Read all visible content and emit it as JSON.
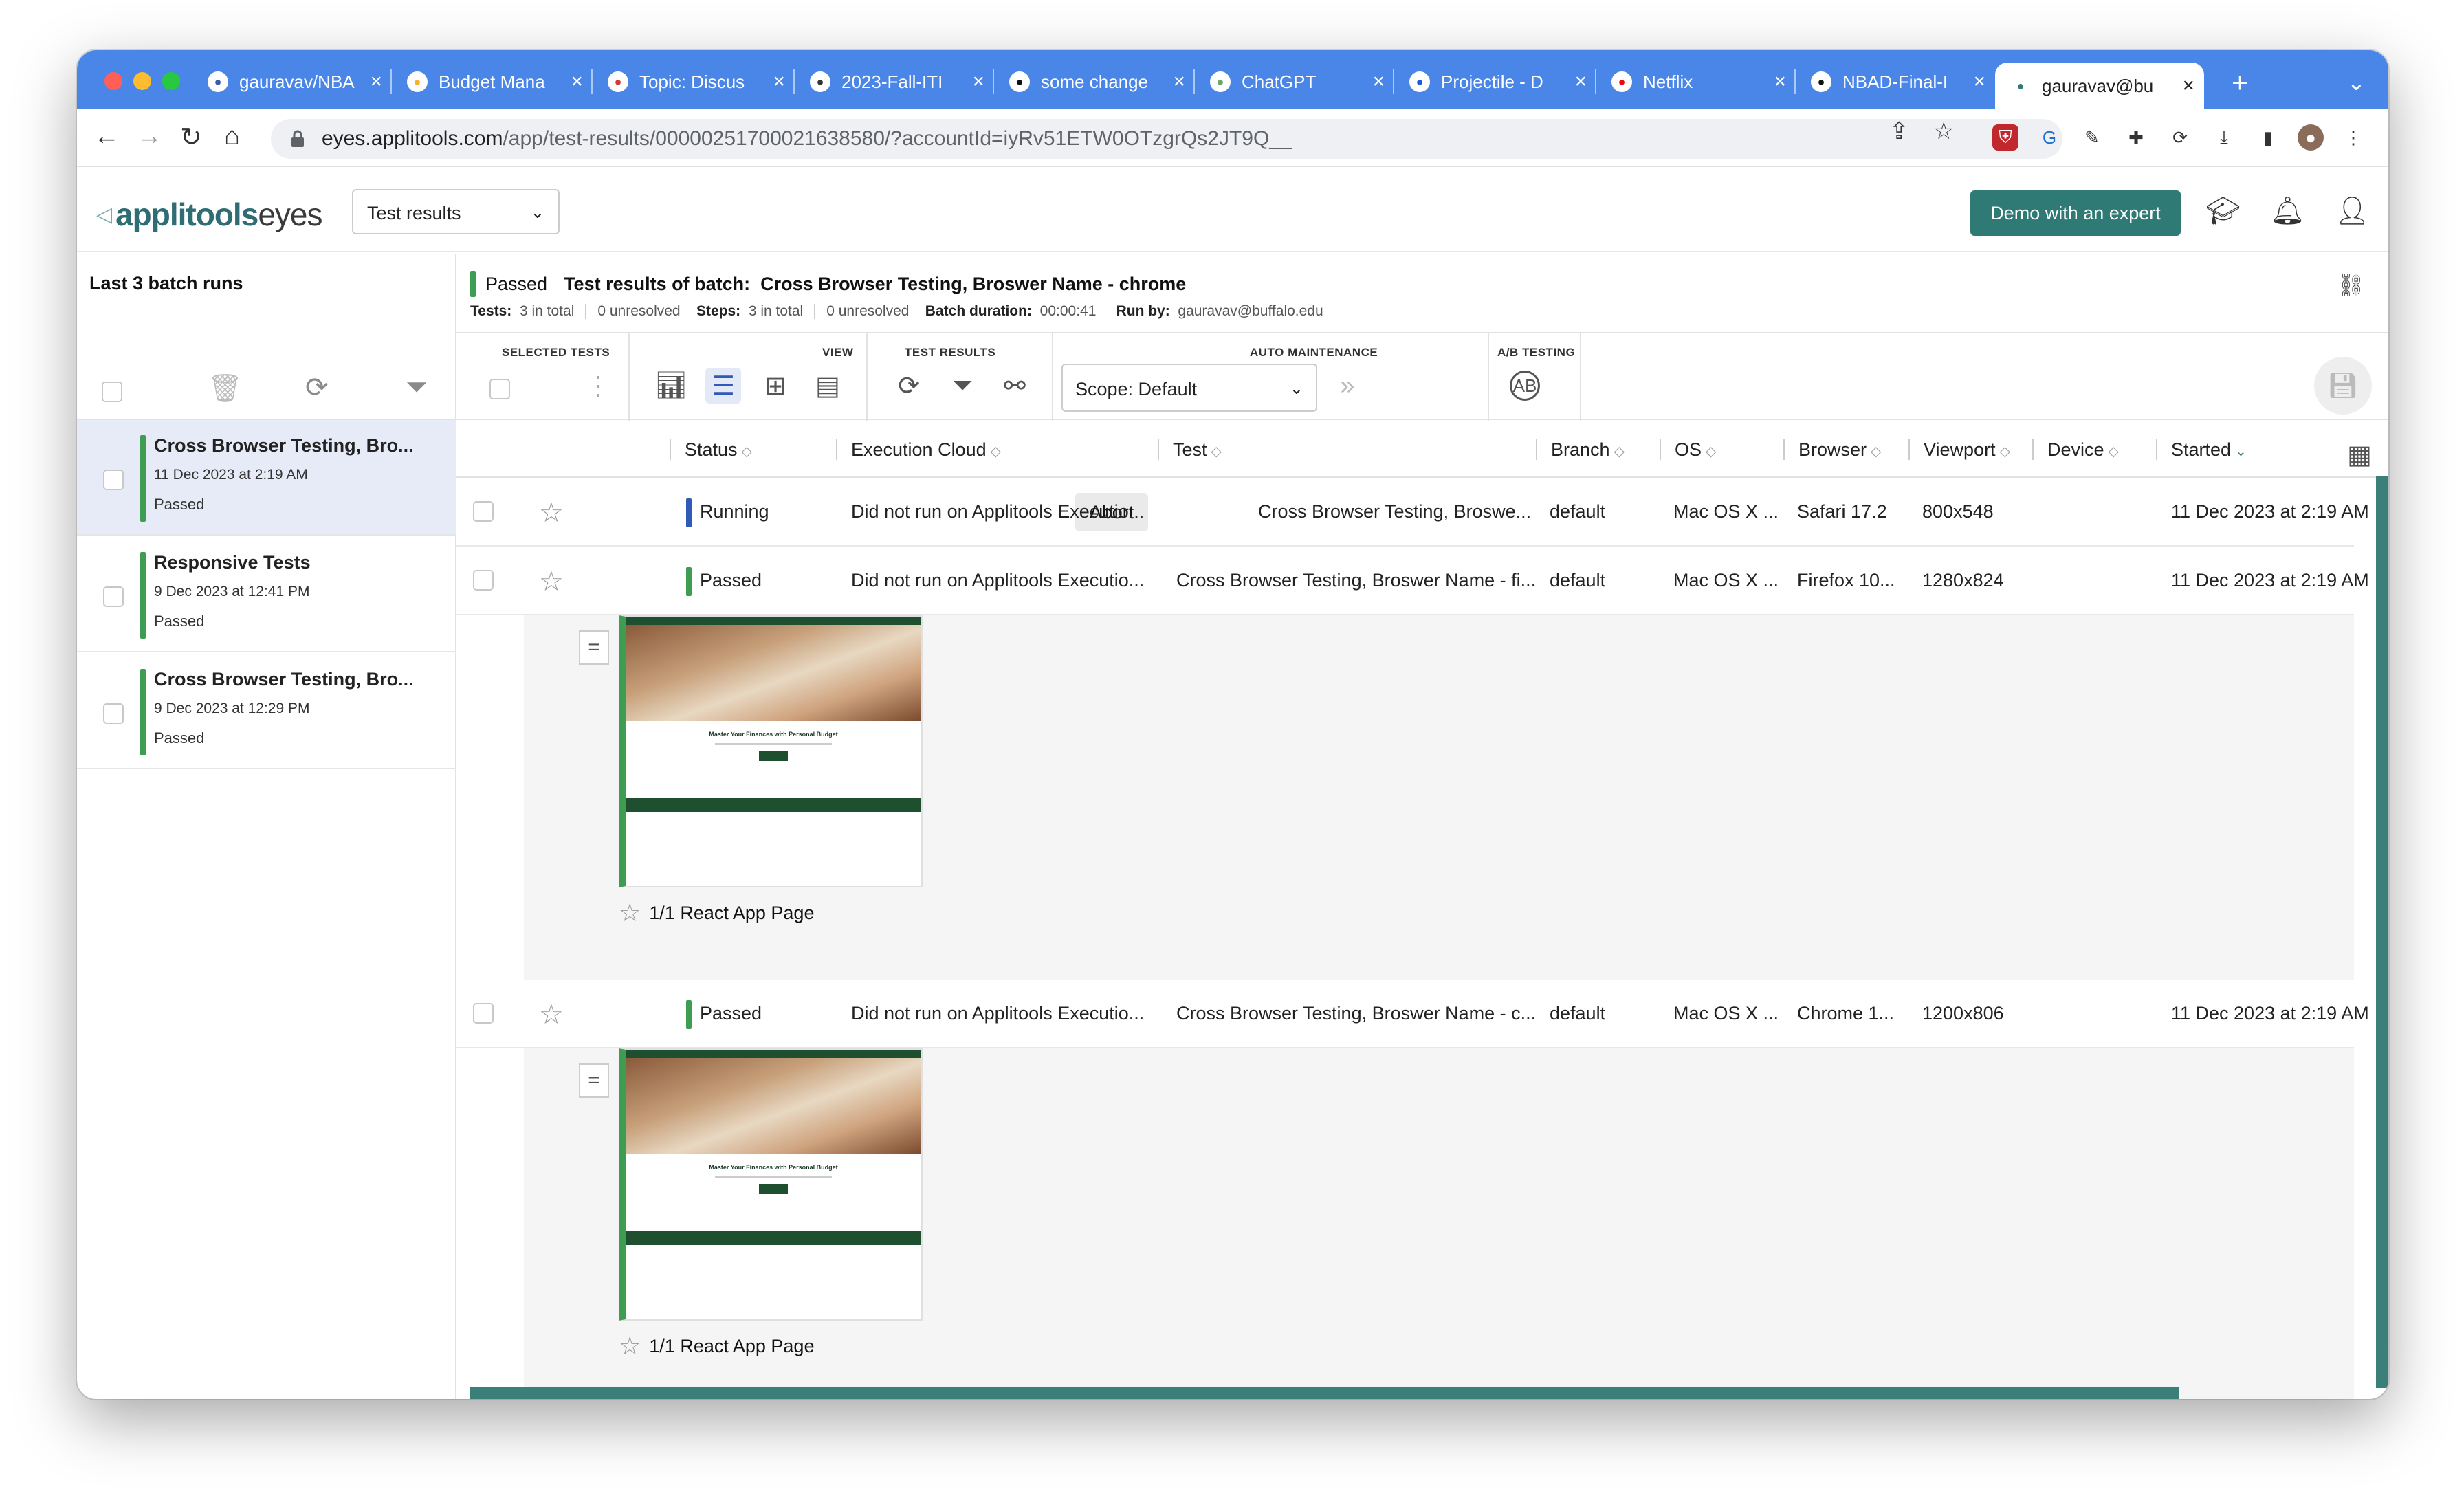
{
  "browser": {
    "tabs": [
      {
        "title": "gauravav/NBA",
        "icon": "github-circle-icon",
        "color": "#3a5ba8"
      },
      {
        "title": "Budget Mana",
        "icon": "budget-app-icon",
        "color": "#f2b233"
      },
      {
        "title": "Topic: Discus",
        "icon": "discourse-icon",
        "color": "#d23a3a"
      },
      {
        "title": "2023-Fall-ITI",
        "icon": "p-icon",
        "color": "#333333"
      },
      {
        "title": "some change",
        "icon": "github-icon",
        "color": "#111111"
      },
      {
        "title": "ChatGPT",
        "icon": "chatgpt-icon",
        "color": "#6aa86a"
      },
      {
        "title": "Projectile - D",
        "icon": "projectile-icon",
        "color": "#1e5bd8"
      },
      {
        "title": "Netflix",
        "icon": "netflix-icon",
        "color": "#e50914"
      },
      {
        "title": "NBAD-Final-I",
        "icon": "github-icon",
        "color": "#111111"
      },
      {
        "title": "gauravav@bu",
        "icon": "applitools-icon",
        "color": "#2f7a74"
      }
    ],
    "url_host": "eyes.applitools.com",
    "url_path": "/app/test-results/00000251700021638580/?accountId=iyRv51ETW0OTzgrQs2JT9Q__"
  },
  "app": {
    "logo_a": "applitools",
    "logo_b": "eyes",
    "view_select": "Test results",
    "demo_button": "Demo with an expert",
    "accent": "#2f7a74"
  },
  "sidebar": {
    "title": "Last 3 batch runs",
    "batches": [
      {
        "name": "Cross Browser Testing, Bro...",
        "date": "11 Dec 2023 at 2:19 AM",
        "status": "Passed"
      },
      {
        "name": "Responsive Tests",
        "date": "9 Dec 2023 at 12:41 PM",
        "status": "Passed"
      },
      {
        "name": "Cross Browser Testing, Bro...",
        "date": "9 Dec 2023 at 12:29 PM",
        "status": "Passed"
      }
    ]
  },
  "batch": {
    "status": "Passed",
    "title_prefix": "Test results of batch:",
    "title": "Cross Browser Testing, Broswer Name - chrome",
    "tests_label": "Tests:",
    "tests_total": "3 in total",
    "tests_unresolved": "0 unresolved",
    "steps_label": "Steps:",
    "steps_total": "3 in total",
    "steps_unresolved": "0 unresolved",
    "duration_label": "Batch duration:",
    "duration": "00:00:41",
    "runby_label": "Run by:",
    "runby": "gauravav@buffalo.edu"
  },
  "toolbar_sections": {
    "selected": "SELECTED TESTS",
    "view": "VIEW",
    "results": "TEST RESULTS",
    "maintenance": "AUTO MAINTENANCE",
    "ab": "A/B TESTING",
    "scope": "Scope: Default"
  },
  "table": {
    "headers": [
      "Status",
      "Execution Cloud",
      "Test",
      "Branch",
      "OS",
      "Browser",
      "Viewport",
      "Device",
      "Started"
    ],
    "abort_label": "Abort",
    "rows": [
      {
        "status": "Running",
        "status_color": "#2f5ab7",
        "cloud": "Did not run on Applitools Executio...",
        "test": "Cross Browser Testing, Broswe...",
        "branch": "default",
        "os": "Mac OS X ...",
        "browser": "Safari 17.2",
        "viewport": "800x548",
        "device": "",
        "started": "11 Dec 2023 at 2:19 AM"
      },
      {
        "status": "Passed",
        "status_color": "#3f9d53",
        "cloud": "Did not run on Applitools Executio...",
        "test": "Cross Browser Testing, Broswer Name - fi...",
        "branch": "default",
        "os": "Mac OS X ...",
        "browser": "Firefox 10...",
        "viewport": "1280x824",
        "device": "",
        "started": "11 Dec 2023 at 2:19 AM"
      },
      {
        "status": "Passed",
        "status_color": "#3f9d53",
        "cloud": "Did not run on Applitools Executio...",
        "test": "Cross Browser Testing, Broswer Name - c...",
        "branch": "default",
        "os": "Mac OS X ...",
        "browser": "Chrome 1...",
        "viewport": "1200x806",
        "device": "",
        "started": "11 Dec 2023 at 2:19 AM"
      }
    ],
    "step_label": "1/1 React App Page",
    "thumb_heading": "Master Your Finances with Personal Budget"
  }
}
